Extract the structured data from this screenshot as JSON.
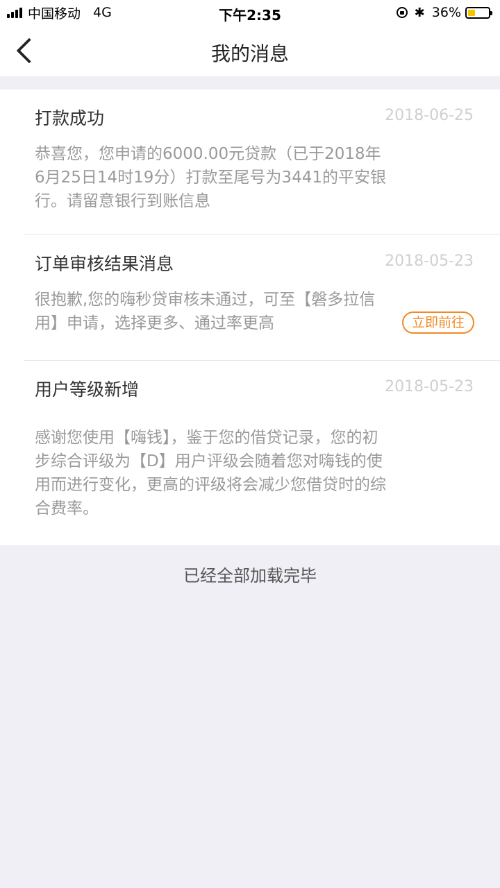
{
  "status_bar": {
    "carrier": "中国移动",
    "network": "4G",
    "time": "下午2:35",
    "bluetooth": "✱",
    "battery_text": "36%",
    "battery_level": 0.36,
    "battery_color": "#f5c400"
  },
  "nav": {
    "title": "我的消息"
  },
  "messages": [
    {
      "title": "打款成功",
      "date": "2018-06-25",
      "body": "恭喜您，您申请的6000.00元贷款（已于2018年6月25日14时19分）打款至尾号为3441的平安银行。请留意银行到账信息"
    },
    {
      "title": "订单审核结果消息",
      "date": "2018-05-23",
      "body": "很抱歉,您的嗨秒贷审核未通过，可至【磐多拉信用】申请，选择更多、通过率更高",
      "action_label": "立即前往"
    },
    {
      "title": "用户等级新增",
      "date": "2018-05-23",
      "body": "感谢您使用【嗨钱】，鉴于您的借贷记录，您的初步综合评级为【D】用户评级会随着您对嗨钱的使用而进行变化，更高的评级将会减少您借贷时的综合费率。"
    }
  ],
  "footer": {
    "text": "已经全部加载完毕"
  },
  "colors": {
    "accent": "#f08a24",
    "page_bg": "#f0eff5"
  }
}
